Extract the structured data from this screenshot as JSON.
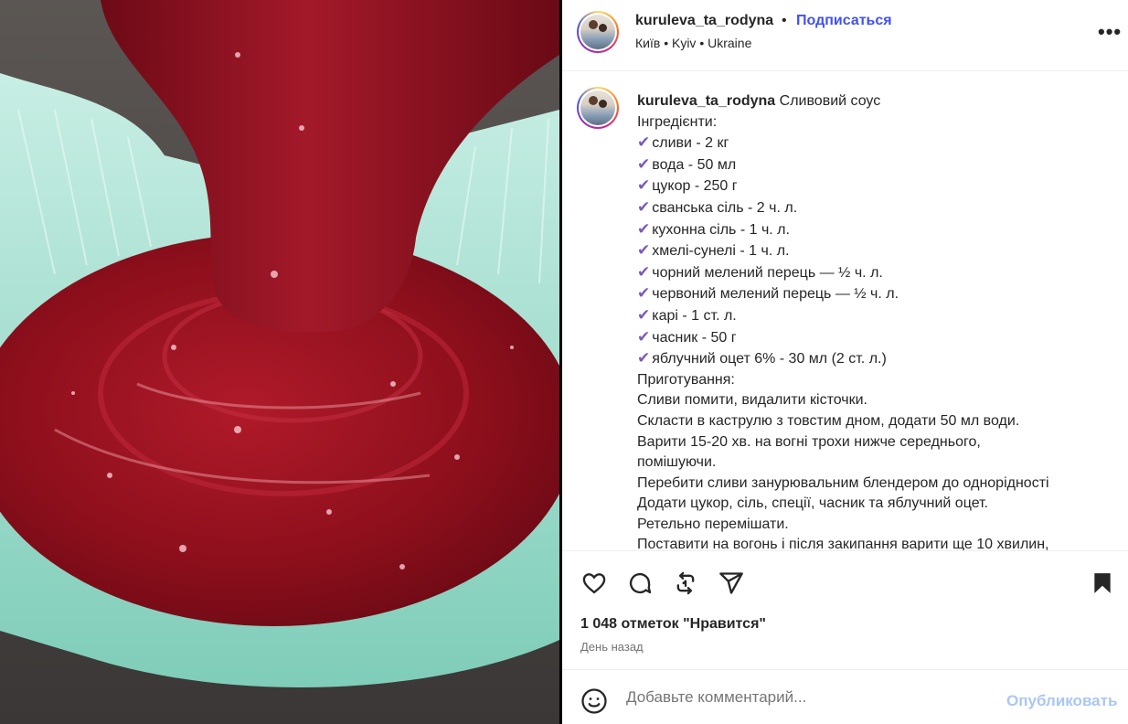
{
  "post": {
    "username": "kuruleva_ta_rodyna",
    "separator": "•",
    "follow_label": "Подписаться",
    "location": "Київ • Kyiv • Ukraine",
    "more_label": "•••"
  },
  "caption": {
    "username": "kuruleva_ta_rodyna",
    "title": "Сливовий соус",
    "lines": [
      {
        "check": false,
        "text": "Інгредієнти:"
      },
      {
        "check": true,
        "text": "сливи - 2 кг"
      },
      {
        "check": true,
        "text": "вода - 50 мл"
      },
      {
        "check": true,
        "text": "цукор - 250 г"
      },
      {
        "check": true,
        "text": "сванська сіль - 2 ч. л."
      },
      {
        "check": true,
        "text": "кухонна сіль - 1 ч. л."
      },
      {
        "check": true,
        "text": "хмелі-сунелі - 1 ч. л."
      },
      {
        "check": true,
        "text": "чорний мелений перець — ½ ч. л."
      },
      {
        "check": true,
        "text": "червоний мелений перець — ½ ч. л."
      },
      {
        "check": true,
        "text": "карі - 1 ст. л."
      },
      {
        "check": true,
        "text": "часник - 50 г"
      },
      {
        "check": true,
        "text": "яблучний оцет 6% - 30 мл (2 ст. л.)"
      },
      {
        "check": false,
        "text": "Приготування:"
      },
      {
        "check": false,
        "text": "Сливи помити, видалити кісточки."
      },
      {
        "check": false,
        "text": "Скласти в каструлю з товстим дном, додати 50 мл води."
      },
      {
        "check": false,
        "text": "Варити 15-20 хв. на вогні трохи нижче середнього,"
      },
      {
        "check": false,
        "text": "помішуючи."
      },
      {
        "check": false,
        "text": "Перебити сливи занурювальним блендером до однорідності"
      },
      {
        "check": false,
        "text": "Додати цукор, сіль, спеції, часник та яблучний оцет."
      },
      {
        "check": false,
        "text": "Ретельно перемішати."
      },
      {
        "check": false,
        "text": "Поставити на вогонь і після закипання варити ще 10 хвилин,"
      }
    ],
    "check_glyph": "✔"
  },
  "actions": {
    "icons": [
      "heart-icon",
      "comment-icon",
      "repost-icon",
      "share-icon",
      "bookmark-icon"
    ],
    "likes": "1 048 отметок \"Нравится\"",
    "date": "День назад"
  },
  "comment": {
    "placeholder": "Добавьте комментарий...",
    "post_label": "Опубликовать"
  },
  "colors": {
    "follow": "#4150f7",
    "post_button": "#aac6f5",
    "check": "#7b5bb8",
    "sauce": "#8e0f1c"
  }
}
